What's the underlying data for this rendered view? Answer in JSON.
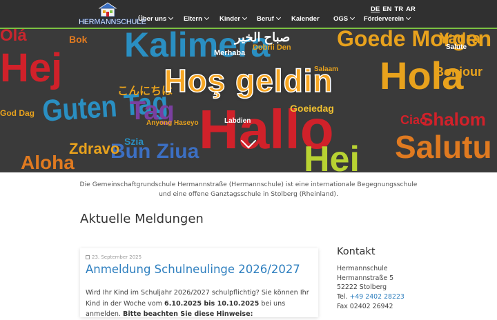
{
  "header": {
    "logo_text": "HERMANNSCHULE",
    "nav": [
      {
        "label": "Über uns",
        "dropdown": true
      },
      {
        "label": "Eltern",
        "dropdown": true
      },
      {
        "label": "Kinder",
        "dropdown": true
      },
      {
        "label": "Beruf",
        "dropdown": true
      },
      {
        "label": "Kalender",
        "dropdown": false
      },
      {
        "label": "OGS",
        "dropdown": true
      },
      {
        "label": "Förderverein",
        "dropdown": true
      }
    ],
    "languages": [
      "DE",
      "EN",
      "TR",
      "AR"
    ],
    "active_language": "DE",
    "accent_color": "#7cc242"
  },
  "hero": {
    "headline": "Hoş geldin",
    "headline_color": "#f6a623",
    "word_cloud": [
      {
        "t": "Kalimera",
        "c": "#2a8fc2"
      },
      {
        "t": "Hola",
        "c": "#e8a21d"
      },
      {
        "t": "Hallo",
        "c": "#d1212a"
      },
      {
        "t": "Hej",
        "c": "#d1212a"
      },
      {
        "t": "Guten Tag",
        "c": "#2a8fc2"
      },
      {
        "t": "Salutu",
        "c": "#e07a20"
      },
      {
        "t": "Shalom",
        "c": "#d1212a"
      },
      {
        "t": "Goede Morgen",
        "c": "#e8a21d"
      },
      {
        "t": "Olá",
        "c": "#c9262e"
      },
      {
        "t": "Hei",
        "c": "#b8d232"
      },
      {
        "t": "Bonjour",
        "c": "#e8a21d"
      },
      {
        "t": "Bun Ziua",
        "c": "#3c6fc2"
      },
      {
        "t": "Zdravo",
        "c": "#e8a21d"
      },
      {
        "t": "Aloha",
        "c": "#e07a20"
      },
      {
        "t": "Yadra",
        "c": "#e8a21d"
      },
      {
        "t": "Ciao",
        "c": "#d1212a"
      },
      {
        "t": "Merhaba",
        "c": "#ffffff"
      },
      {
        "t": "Goeiedag",
        "c": "#f0c030"
      },
      {
        "t": "Dobrii Den",
        "c": "#e8a21d"
      },
      {
        "t": "Tag",
        "c": "#7a3fa0"
      },
      {
        "t": "Szia",
        "c": "#2a8fc2"
      },
      {
        "t": "صباح الخير",
        "c": "#ffffff"
      },
      {
        "t": "こんにちは",
        "c": "#e8a21d"
      },
      {
        "t": "Bok",
        "c": "#e07a20"
      },
      {
        "t": "Anyong Haseyo",
        "c": "#e8a21d"
      },
      {
        "t": "Salaam",
        "c": "#e8a21d"
      },
      {
        "t": "God Dag",
        "c": "#e8a21d"
      },
      {
        "t": "Labdien",
        "c": "#ffffff"
      },
      {
        "t": "Salute",
        "c": "#ffffff"
      }
    ]
  },
  "intro": {
    "line1": "Die Gemeinschaftgrundschule Hermannstraße (Hermannschule) ist eine internationale Begegnungsschule",
    "line2": "und eine offene Ganztagsschule in Stolberg (Rheinland)."
  },
  "news": {
    "section_title": "Aktuelle Meldungen",
    "posts": [
      {
        "date": "23. September 2025",
        "title": "Anmeldung Schulneulinge 2026/2027",
        "text_1": "Wird Ihr Kind im Schuljahr 2026/2027 schulpflichtig? Sie können Ihr Kind in der Woche vom ",
        "bold_dates": "6.10.2025 bis 10.10.2025",
        "text_2": " bei uns anmelden. ",
        "bold_note": "Bitte beachten Sie diese Hinweise:"
      }
    ]
  },
  "contact": {
    "title": "Kontakt",
    "name": "Hermannschule",
    "street": "Hermannstraße 5",
    "city": "52222 Stolberg",
    "tel_label": "Tel.",
    "tel": "+49 2402 28223",
    "fax": "Fax 02402 26942"
  }
}
